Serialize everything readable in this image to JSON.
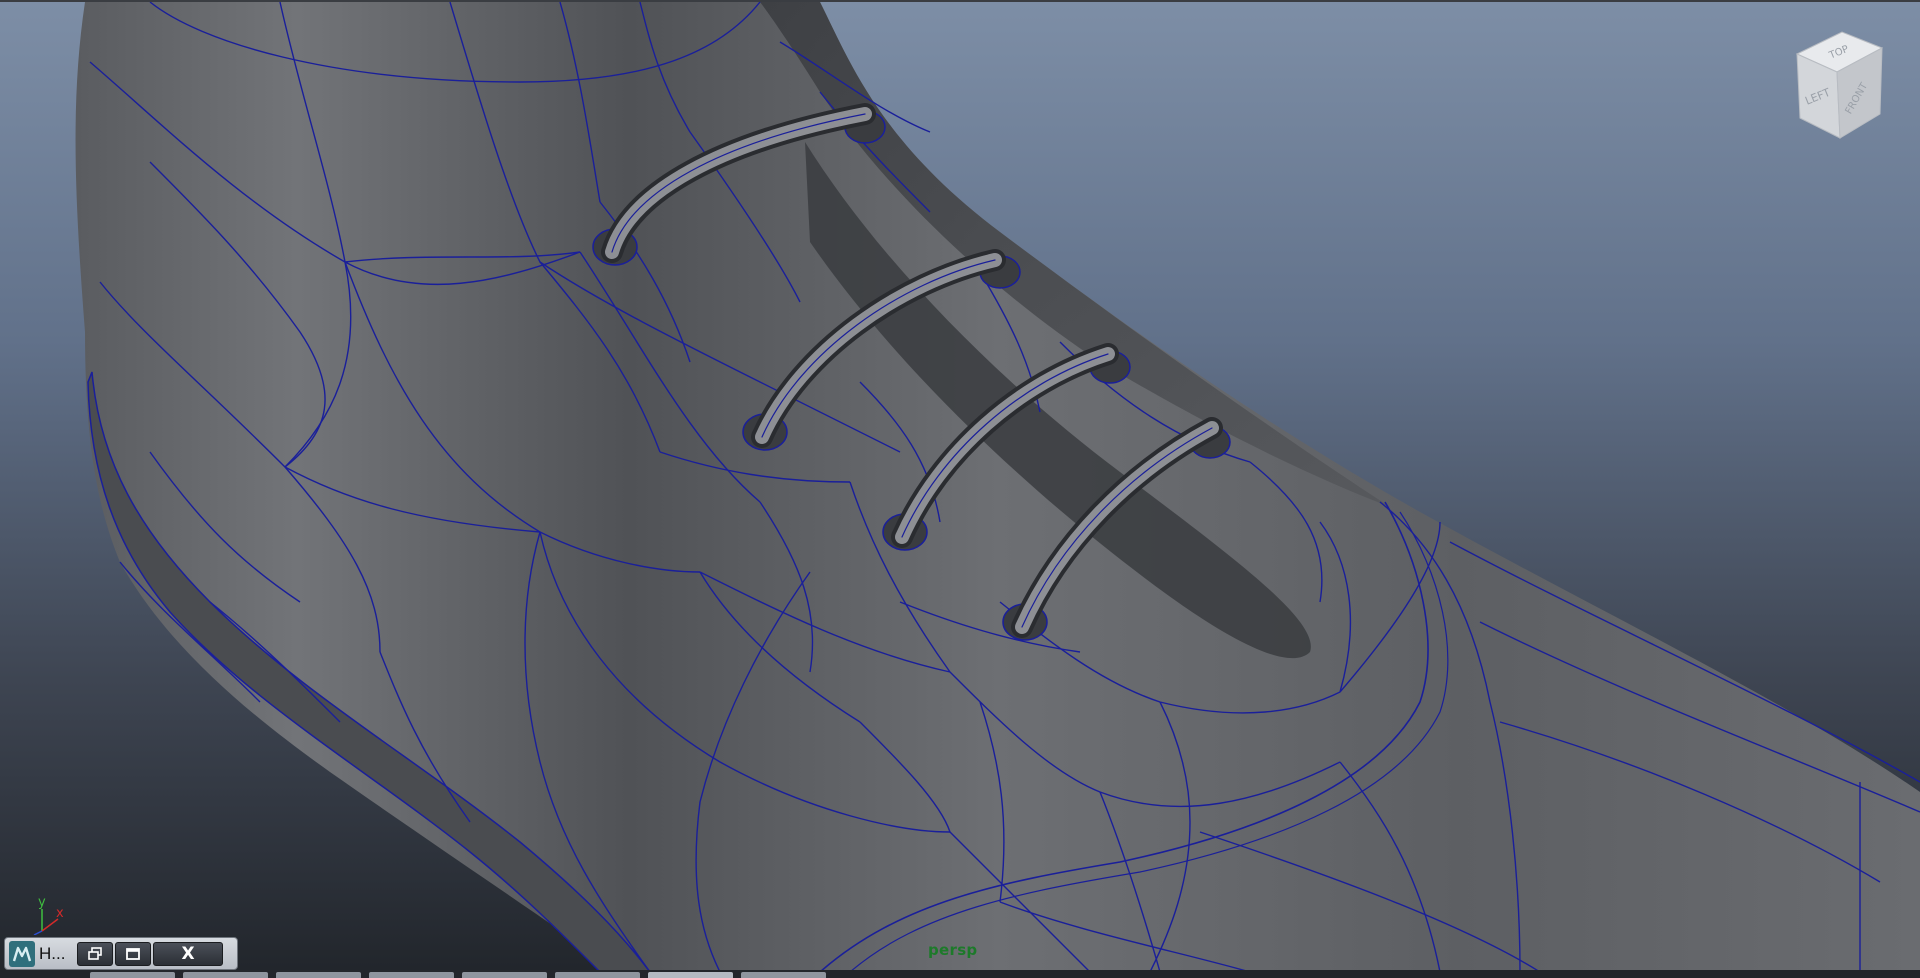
{
  "viewport": {
    "camera_label": "persp",
    "background_top": "#7d8ea6",
    "background_bottom": "#22262c",
    "wireframe_color": "#1a1f9a",
    "surface_color": "#6a6c70"
  },
  "view_cube": {
    "top_label": "TOP",
    "left_label": "LEFT",
    "front_label": "FRONT"
  },
  "axis_indicator": {
    "y_label": "y",
    "x_label": "x"
  },
  "minimized_window": {
    "icon": "maya-app-icon",
    "title": "H...",
    "restore_icon": "restore-icon",
    "maximize_icon": "maximize-icon",
    "close_label": "X"
  },
  "taskbar": {
    "icon": "taskbar-strip"
  }
}
